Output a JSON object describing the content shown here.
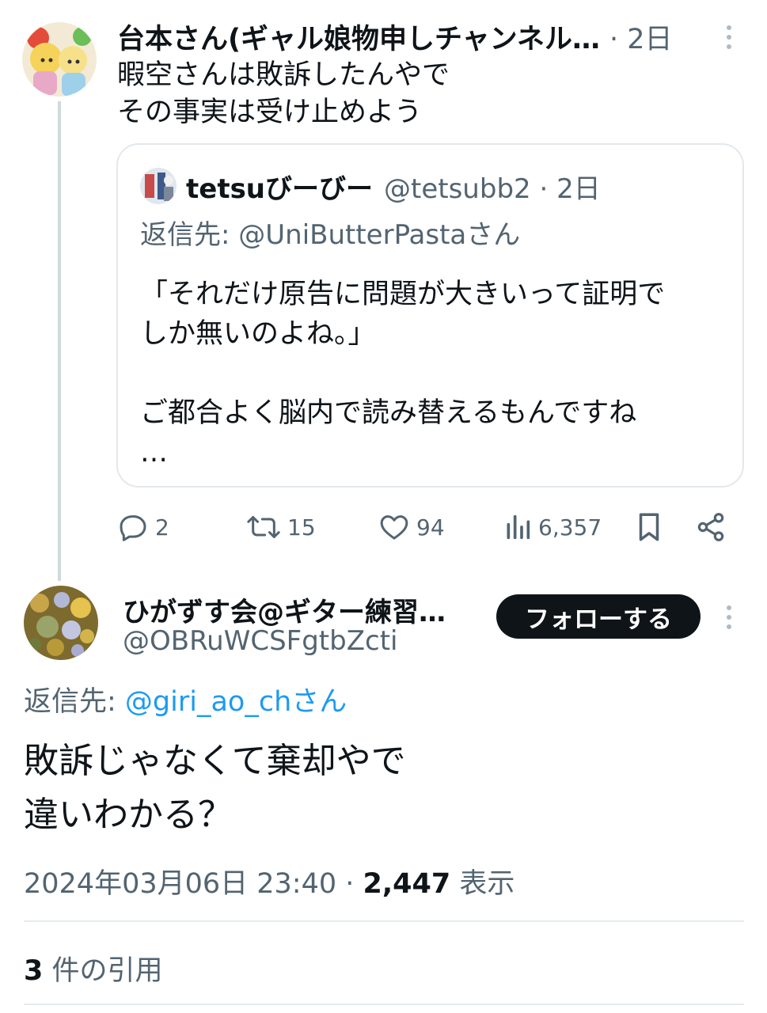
{
  "parent_tweet": {
    "display_name": "台本さん(ギャル娘物申しチャンネル…",
    "time_ago": "· 2日",
    "text_lines": [
      "暇空さんは敗訴したんやで",
      "その事実は受け止めよう"
    ]
  },
  "quoted_tweet": {
    "display_name": "tetsuびーびー",
    "handle_time": "@tetsubb2 · 2日",
    "reply_prefix": "返信先: ",
    "reply_target": "@UniButterPasta",
    "reply_suffix": "さん",
    "text_lines": [
      "「それだけ原告に問題が大きいって証明で",
      "しか無いのよね。」",
      "",
      "ご都合よく脳内で読み替えるもんですね",
      "…"
    ]
  },
  "actions": {
    "replies": "2",
    "retweets": "15",
    "likes": "94",
    "views": "6,357"
  },
  "main_tweet": {
    "display_name": "ひがずす会@ギター練習…",
    "handle": "@OBRuWCSFgtbZcti",
    "follow_label": "フォローする",
    "reply_prefix": "返信先: ",
    "reply_target": "@giri_ao_ch",
    "reply_suffix": "さん",
    "text_lines": [
      "敗訴じゃなくて棄却やで",
      "違いわかる？"
    ],
    "timestamp": "2024年03月06日 23:40 · ",
    "views_count": "2,447",
    "views_label": " 表示"
  },
  "quotes": {
    "count": "3",
    "label": " 件の引用"
  },
  "icons": [
    "reply-icon",
    "retweet-icon",
    "like-icon",
    "views-icon",
    "bookmark-icon",
    "share-icon",
    "more-icon"
  ],
  "colors": {
    "text": "#0f1419",
    "muted": "#536471",
    "link": "#1d9bf0",
    "border": "#e3e8ec",
    "button": "#0f1419"
  }
}
